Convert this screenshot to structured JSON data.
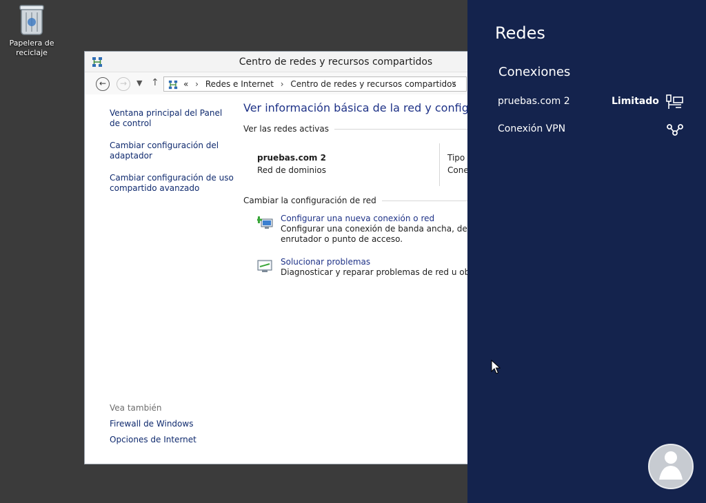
{
  "desktop": {
    "recycle_bin_label": "Papelera de reciclaje"
  },
  "window": {
    "title": "Centro de redes y recursos compartidos",
    "nav": {
      "back_icon": "back-arrow-icon",
      "forward_icon": "forward-arrow-icon",
      "recent_icon": "chevron-down-icon",
      "up_icon": "up-arrow-icon"
    },
    "address": {
      "prefix": "«",
      "crumbs": [
        "Redes e Internet",
        "Centro de redes y recursos compartidos"
      ]
    },
    "sidebar": {
      "links": [
        "Ventana principal del Panel de control",
        "Cambiar configuración del adaptador",
        "Cambiar configuración de uso compartido avanzado"
      ],
      "see_also_label": "Vea también",
      "see_also_links": [
        "Firewall de Windows",
        "Opciones de Internet"
      ]
    },
    "main": {
      "heading": "Ver información básica de la red y configurar co",
      "active_networks_label": "Ver las redes activas",
      "network": {
        "name": "pruebas.com  2",
        "type": "Red de dominios",
        "col_label": "Tipo c",
        "col_value": "Conex"
      },
      "change_label": "Cambiar la configuración de red",
      "tasks": [
        {
          "link": "Configurar una nueva conexión o red",
          "desc_lines": [
            "Configurar una conexión de banda ancha, de acceso",
            "enrutador o punto de acceso."
          ]
        },
        {
          "link": "Solucionar problemas",
          "desc_lines": [
            "Diagnosticar y reparar problemas de red u obtener i"
          ]
        }
      ]
    }
  },
  "charm": {
    "title": "Redes",
    "section": "Conexiones",
    "connections": [
      {
        "name": "pruebas.com  2",
        "status": "Limitado",
        "icon": "wired-network-icon"
      },
      {
        "name": "Conexión VPN",
        "status": "",
        "icon": "vpn-icon"
      }
    ]
  },
  "colors": {
    "charm_bg": "#14234d",
    "link_blue": "#1e3287",
    "desktop_bg": "#3b3b3b"
  }
}
